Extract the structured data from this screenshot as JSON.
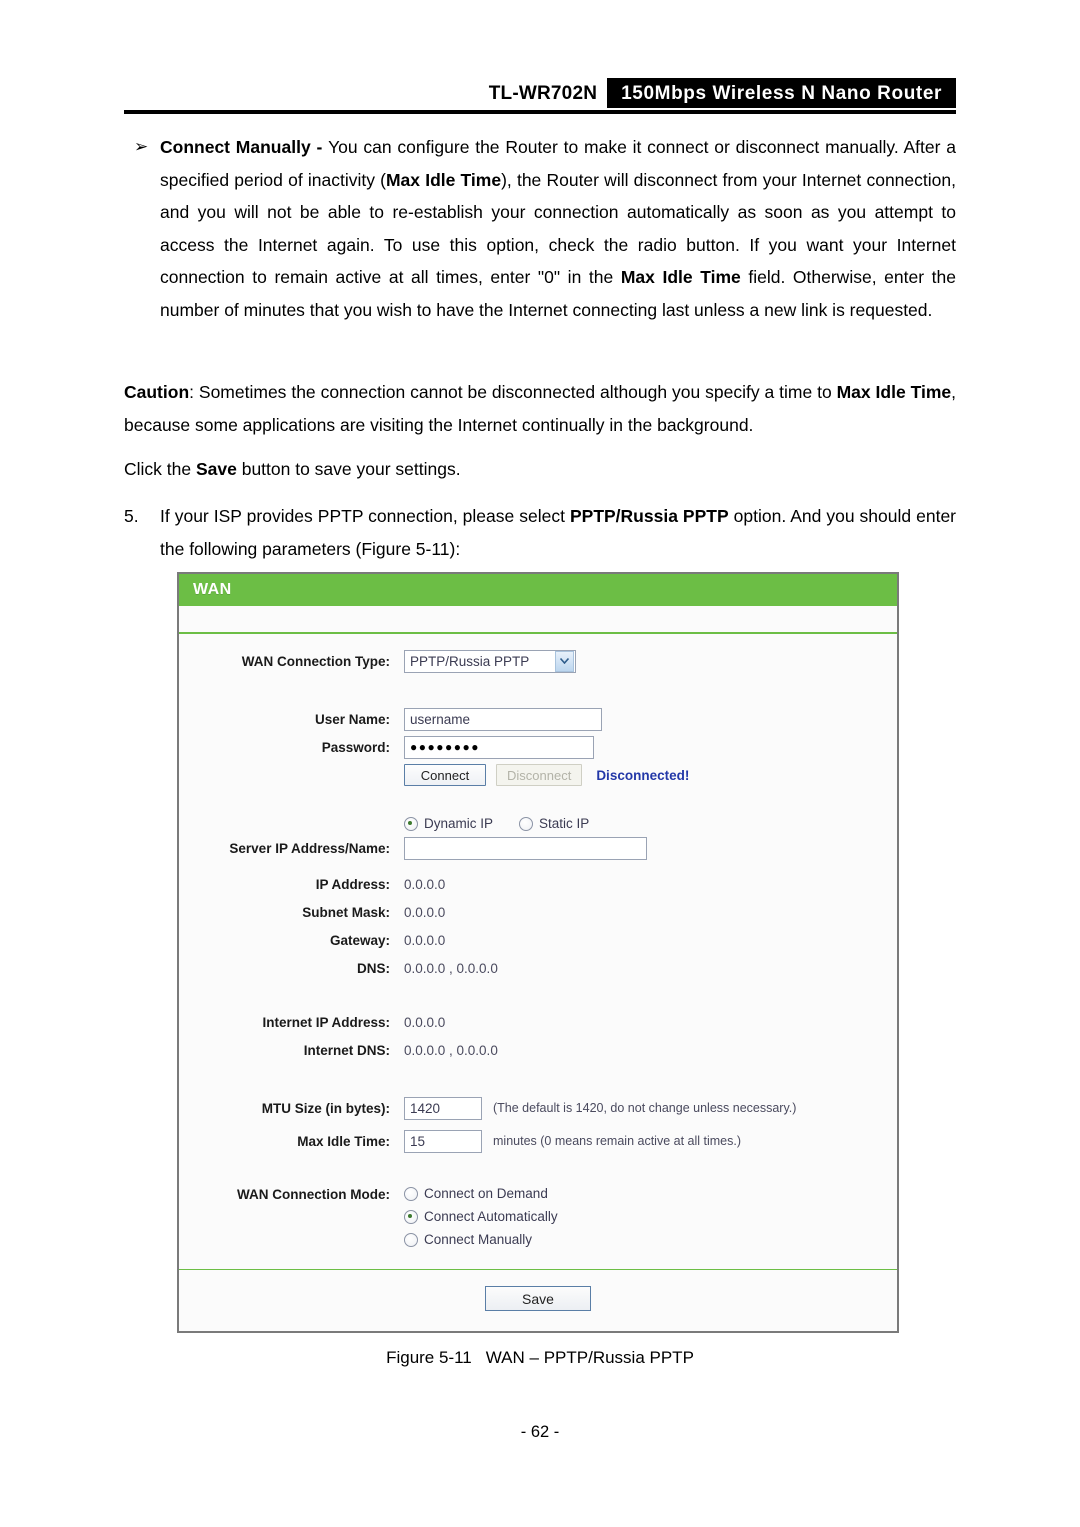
{
  "header": {
    "model": "TL-WR702N",
    "product": "150Mbps Wireless N Nano Router"
  },
  "content": {
    "bullet_marker": "➢",
    "bullet_title": "Connect Manually - ",
    "bullet_body_1": "You can configure the Router to make it connect or disconnect manually. After a specified period of inactivity (",
    "bullet_bold_1": "Max Idle Time",
    "bullet_body_2": "), the Router will disconnect from your Internet connection, and you will not be able to re-establish your connection automatically as soon as you attempt to access the Internet again. To use this option, check the radio button. If you want your Internet connection to remain active at all times, enter \"0\" in the ",
    "bullet_bold_2": "Max Idle Time",
    "bullet_body_3": " field. Otherwise, enter the number of minutes that you wish to have the Internet connecting last unless a new link is requested.",
    "caution_label": "Caution",
    "caution_body_1": ": Sometimes the connection cannot be disconnected although you specify a time to ",
    "caution_bold_1": "Max Idle Time",
    "caution_body_2": ", because some applications are visiting the Internet continually in the background.",
    "save_line_1": "Click the ",
    "save_line_bold": "Save",
    "save_line_2": " button to save your settings.",
    "step_number": "5.",
    "step_body_1": "If your ISP provides PPTP connection, please select ",
    "step_bold_1": "PPTP/Russia PPTP",
    "step_body_2": " option. And you should enter the following parameters (Figure 5-11):"
  },
  "wan": {
    "panel_title": "WAN",
    "labels": {
      "wan_connection_type": "WAN Connection Type:",
      "user_name": "User Name:",
      "password": "Password:",
      "server_ip": "Server IP Address/Name:",
      "ip_address": "IP Address:",
      "subnet_mask": "Subnet Mask:",
      "gateway": "Gateway:",
      "dns": "DNS:",
      "internet_ip_address": "Internet IP Address:",
      "internet_dns": "Internet DNS:",
      "mtu_size": "MTU Size (in bytes):",
      "max_idle_time": "Max Idle Time:",
      "wan_connection_mode": "WAN Connection Mode:"
    },
    "connection_type": {
      "selected": "PPTP/Russia PPTP",
      "options": [
        "PPTP/Russia PPTP"
      ]
    },
    "user_name_value": "username",
    "password_value": "●●●●●●●●",
    "buttons": {
      "connect": "Connect",
      "disconnect": "Disconnect",
      "save": "Save"
    },
    "status": "Disconnected!",
    "ip_mode": {
      "dynamic": "Dynamic IP",
      "static": "Static IP",
      "selected": "Dynamic IP"
    },
    "server_ip_value": "",
    "values": {
      "ip_address": "0.0.0.0",
      "subnet_mask": "0.0.0.0",
      "gateway": "0.0.0.0",
      "dns": "0.0.0.0 , 0.0.0.0",
      "internet_ip_address": "0.0.0.0",
      "internet_dns": "0.0.0.0 , 0.0.0.0"
    },
    "mtu_value": "1420",
    "mtu_hint": "(The default is 1420, do not change unless necessary.)",
    "max_idle_value": "15",
    "max_idle_hint": "minutes (0 means remain active at all times.)",
    "connection_mode": {
      "options": [
        "Connect on Demand",
        "Connect Automatically",
        "Connect Manually"
      ],
      "selected": "Connect Automatically"
    },
    "colors": {
      "header_green": "#6cbe45",
      "status_blue": "#2338a8"
    }
  },
  "figure": {
    "number": "Figure 5-11",
    "caption": "WAN – PPTP/Russia PPTP"
  },
  "footer": {
    "page": "- 62 -"
  }
}
